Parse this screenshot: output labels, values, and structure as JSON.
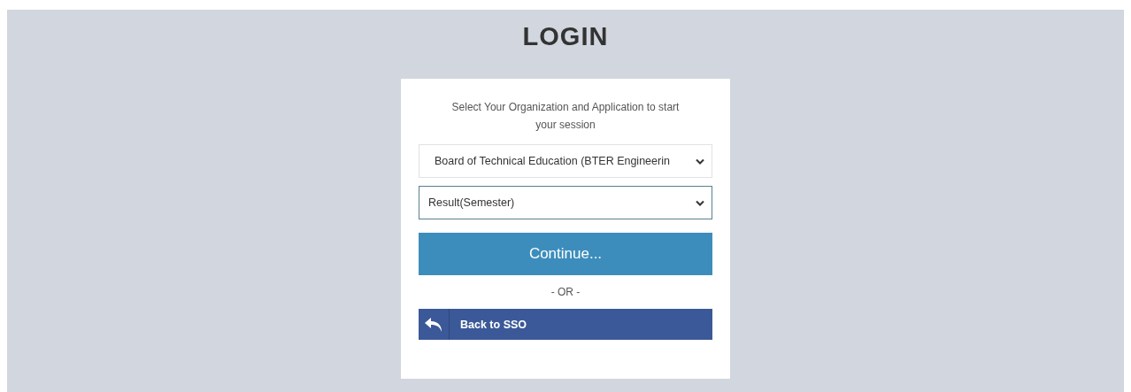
{
  "title": "LOGIN",
  "card": {
    "instruction": "Select Your Organization and Application to start your session",
    "selects": [
      {
        "value": "Board of Technical Education (BTER Engineerin",
        "focused": false
      },
      {
        "value": "Result(Semester)",
        "focused": true
      }
    ],
    "continue_button": "Continue...",
    "separator": "- OR -",
    "back_button": "Back to SSO"
  }
}
